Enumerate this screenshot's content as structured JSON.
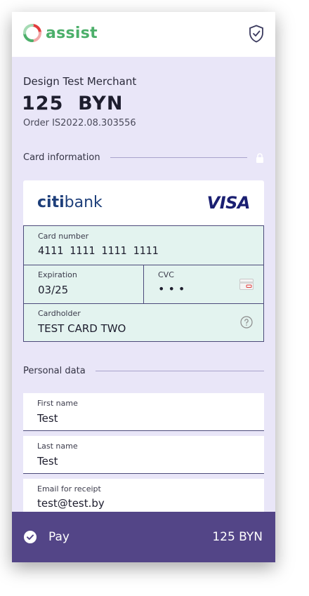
{
  "header": {
    "logo_text": "assist",
    "shield_icon": "shield-check-icon"
  },
  "order": {
    "merchant": "Design Test Merchant",
    "amount": "125  BYN",
    "order_number": "Order IS2022.08.303556"
  },
  "card_section": {
    "title": "Card information",
    "lock_icon": "lock-icon",
    "bank_name_prefix": "citi",
    "bank_name_suffix": "bank",
    "network": "VISA",
    "card_number_label": "Card number",
    "card_number_value": "4111 1111 1111 1111",
    "expiration_label": "Expiration",
    "expiration_value": "03/25",
    "cvc_label": "CVC",
    "cvc_value": "•••",
    "cardholder_label": "Cardholder",
    "cardholder_value": "TEST CARD TWO"
  },
  "personal_section": {
    "title": "Personal data",
    "first_name_label": "First name",
    "first_name_value": "Test",
    "last_name_label": "Last name",
    "last_name_value": "Test",
    "email_label": "Email for receipt",
    "email_value": "test@test.by"
  },
  "pay_bar": {
    "label": "Pay",
    "amount": "125 BYN"
  },
  "colors": {
    "brand_green": "#4caf6a",
    "accent_purple": "#534587",
    "card_fields_bg": "#e3f3ef",
    "page_bg": "#e9e6f8"
  }
}
